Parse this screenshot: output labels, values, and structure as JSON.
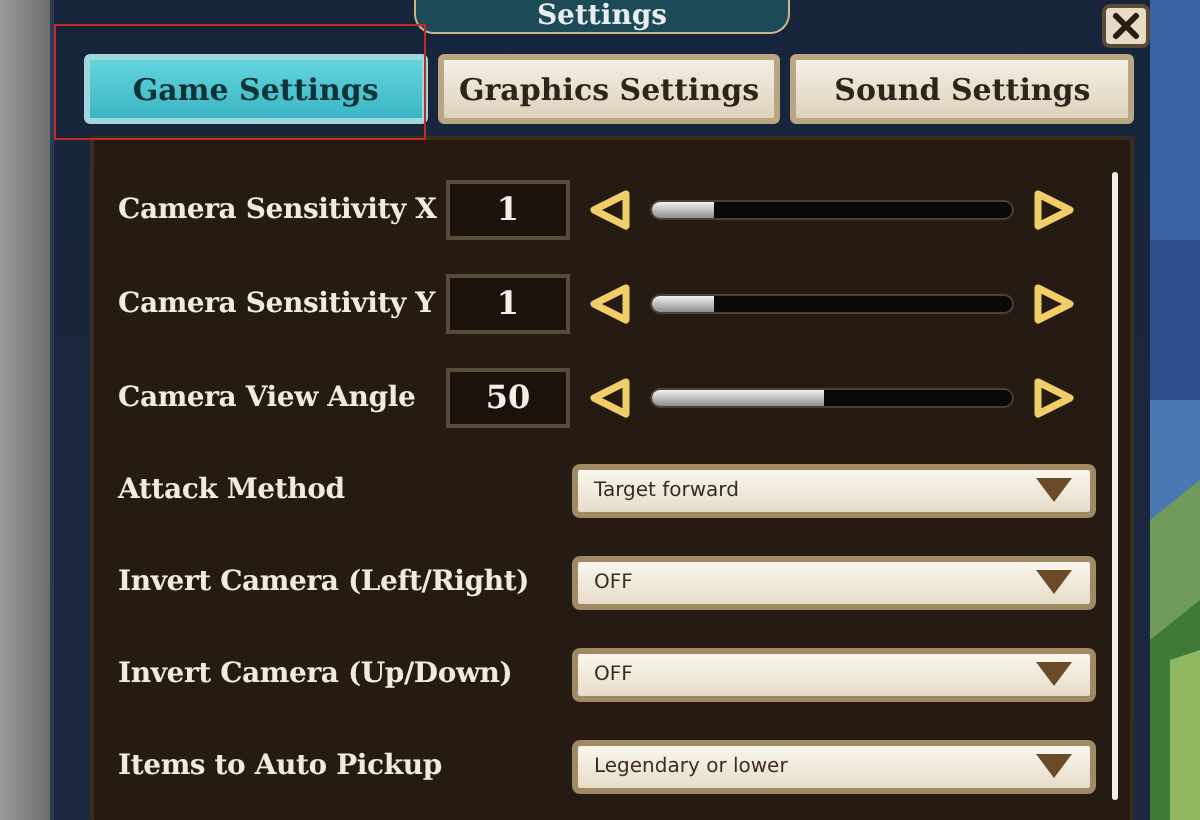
{
  "window": {
    "title": "Settings"
  },
  "tabs": [
    {
      "label": "Game Settings",
      "selected": true
    },
    {
      "label": "Graphics Settings",
      "selected": false
    },
    {
      "label": "Sound Settings",
      "selected": false
    }
  ],
  "settings": [
    {
      "kind": "slider",
      "label": "Camera Sensitivity X",
      "value": "1",
      "level": 0.17
    },
    {
      "kind": "slider",
      "label": "Camera Sensitivity Y",
      "value": "1",
      "level": 0.17
    },
    {
      "kind": "slider",
      "label": "Camera View Angle",
      "value": "50",
      "level": 0.48
    },
    {
      "kind": "dropdown",
      "label": "Attack Method",
      "value": "Target forward"
    },
    {
      "kind": "dropdown",
      "label": "Invert Camera (Left/Right)",
      "value": "OFF"
    },
    {
      "kind": "dropdown",
      "label": "Invert Camera (Up/Down)",
      "value": "OFF"
    },
    {
      "kind": "dropdown",
      "label": "Items to Auto Pickup",
      "value": "Legendary or lower"
    }
  ]
}
